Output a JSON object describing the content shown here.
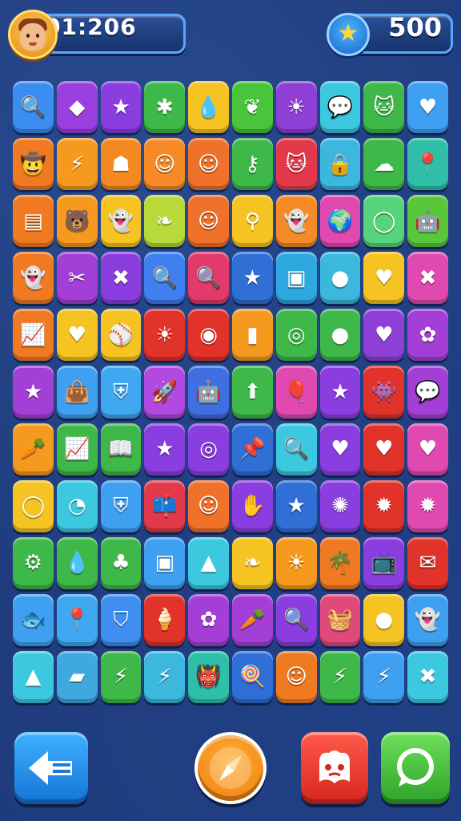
{
  "hud": {
    "timer": "01:206",
    "score": "500",
    "avatar_icon": "player-avatar",
    "score_icon": "star-coin-icon"
  },
  "colors": {
    "background": "#1e3c7c",
    "hud_border": "#5aa7ff"
  },
  "grid": {
    "rows": 11,
    "cols": 10,
    "tiles": [
      [
        {
          "icon": "magnifier",
          "color": "#3b8ef0"
        },
        {
          "icon": "gem",
          "color": "#9b3fe0"
        },
        {
          "icon": "star",
          "color": "#8a3ee0"
        },
        {
          "icon": "bug",
          "color": "#3fb84a"
        },
        {
          "icon": "drop",
          "color": "#f5c422"
        },
        {
          "icon": "leaf",
          "color": "#49c43b"
        },
        {
          "icon": "sun",
          "color": "#8e3fd6"
        },
        {
          "icon": "chat-bubble",
          "color": "#3cc8df"
        },
        {
          "icon": "cat",
          "color": "#3fb84a"
        },
        {
          "icon": "heart",
          "color": "#3f9ff0"
        }
      ],
      [
        {
          "icon": "cowboy",
          "color": "#f07a22"
        },
        {
          "icon": "lightning",
          "color": "#f59a1f"
        },
        {
          "icon": "idol",
          "color": "#f48a1f"
        },
        {
          "icon": "face",
          "color": "#f58a26"
        },
        {
          "icon": "face",
          "color": "#f0712a"
        },
        {
          "icon": "key",
          "color": "#3fb84a"
        },
        {
          "icon": "cat",
          "color": "#e23a4a"
        },
        {
          "icon": "lock",
          "color": "#3cb8df"
        },
        {
          "icon": "cloud",
          "color": "#3fb84a"
        },
        {
          "icon": "map-pin",
          "color": "#2fbfa8"
        }
      ],
      [
        {
          "icon": "card",
          "color": "#f07a22"
        },
        {
          "icon": "bear",
          "color": "#f59a1f"
        },
        {
          "icon": "ghost",
          "color": "#f5c422"
        },
        {
          "icon": "sprout",
          "color": "#b8d93a"
        },
        {
          "icon": "face",
          "color": "#f0712a"
        },
        {
          "icon": "flashlight",
          "color": "#f5c422"
        },
        {
          "icon": "ghost",
          "color": "#f58a26"
        },
        {
          "icon": "globe",
          "color": "#e04ab0"
        },
        {
          "icon": "ring",
          "color": "#57d37a"
        },
        {
          "icon": "robot",
          "color": "#59c73a"
        }
      ],
      [
        {
          "icon": "ghost",
          "color": "#f07a22"
        },
        {
          "icon": "cross-tools",
          "color": "#a33fd6"
        },
        {
          "icon": "x-mark",
          "color": "#8a3ee0"
        },
        {
          "icon": "magnifier",
          "color": "#3f7ff0"
        },
        {
          "icon": "magnifier",
          "color": "#e23a6a"
        },
        {
          "icon": "star",
          "color": "#2f6fd6"
        },
        {
          "icon": "frame",
          "color": "#2fa8df"
        },
        {
          "icon": "lemon",
          "color": "#3cb8df"
        },
        {
          "icon": "heart",
          "color": "#f5c422"
        },
        {
          "icon": "x-mark",
          "color": "#e04ab0"
        }
      ],
      [
        {
          "icon": "chart",
          "color": "#f07a22"
        },
        {
          "icon": "heart",
          "color": "#f5c422"
        },
        {
          "icon": "ball",
          "color": "#f5c422"
        },
        {
          "icon": "sun",
          "color": "#e2332a"
        },
        {
          "icon": "eye",
          "color": "#e2332a"
        },
        {
          "icon": "battery",
          "color": "#f59a1f"
        },
        {
          "icon": "webcam",
          "color": "#3fb84a"
        },
        {
          "icon": "berry",
          "color": "#3fb84a"
        },
        {
          "icon": "heart",
          "color": "#8e3fd6"
        },
        {
          "icon": "flower",
          "color": "#a33fd6"
        }
      ],
      [
        {
          "icon": "star",
          "color": "#a33fd6"
        },
        {
          "icon": "bag",
          "color": "#3f9ff0"
        },
        {
          "icon": "shield",
          "color": "#3fa8f0"
        },
        {
          "icon": "rocket",
          "color": "#b04ae0"
        },
        {
          "icon": "robot",
          "color": "#3f6fe0"
        },
        {
          "icon": "arrow-up",
          "color": "#3fb84a"
        },
        {
          "icon": "balloon",
          "color": "#e04ab0"
        },
        {
          "icon": "star",
          "color": "#8a3ee0"
        },
        {
          "icon": "invader",
          "color": "#e2332a"
        },
        {
          "icon": "chat-bubble",
          "color": "#a33fd6"
        }
      ],
      [
        {
          "icon": "carrot",
          "color": "#f59a1f"
        },
        {
          "icon": "chart",
          "color": "#3fb84a"
        },
        {
          "icon": "book",
          "color": "#3fb84a"
        },
        {
          "icon": "star",
          "color": "#8a3ee0"
        },
        {
          "icon": "target",
          "color": "#8a3ee0"
        },
        {
          "icon": "pin",
          "color": "#2f6fd6"
        },
        {
          "icon": "magnifier",
          "color": "#3cc8df"
        },
        {
          "icon": "heart",
          "color": "#8a3ee0"
        },
        {
          "icon": "heart",
          "color": "#e2332a"
        },
        {
          "icon": "heart",
          "color": "#e04ab0"
        }
      ],
      [
        {
          "icon": "ring",
          "color": "#f5c422"
        },
        {
          "icon": "pie",
          "color": "#3cc8df"
        },
        {
          "icon": "shield",
          "color": "#3f9ff0"
        },
        {
          "icon": "mailbox",
          "color": "#e23a4a"
        },
        {
          "icon": "face",
          "color": "#f0712a"
        },
        {
          "icon": "hand",
          "color": "#8a3ee0"
        },
        {
          "icon": "star",
          "color": "#2f6fd6"
        },
        {
          "icon": "virus",
          "color": "#8a3ee0"
        },
        {
          "icon": "splat",
          "color": "#e2332a"
        },
        {
          "icon": "splat",
          "color": "#e04ab0"
        }
      ],
      [
        {
          "icon": "gear",
          "color": "#3fb84a"
        },
        {
          "icon": "drop",
          "color": "#3fb84a"
        },
        {
          "icon": "plant",
          "color": "#3fb84a"
        },
        {
          "icon": "frame",
          "color": "#3f9ff0"
        },
        {
          "icon": "tree",
          "color": "#3cc8df"
        },
        {
          "icon": "feather",
          "color": "#f5c422"
        },
        {
          "icon": "sun",
          "color": "#f59a1f"
        },
        {
          "icon": "palm",
          "color": "#f07a22"
        },
        {
          "icon": "tv",
          "color": "#8a3ee0"
        },
        {
          "icon": "note",
          "color": "#e2332a"
        }
      ],
      [
        {
          "icon": "fish",
          "color": "#3f9ff0"
        },
        {
          "icon": "map-pin",
          "color": "#3fa8f0"
        },
        {
          "icon": "tooth",
          "color": "#3f8ef0"
        },
        {
          "icon": "ice-cream",
          "color": "#e2332a"
        },
        {
          "icon": "flower",
          "color": "#a33fd6"
        },
        {
          "icon": "carrot",
          "color": "#a33fd6"
        },
        {
          "icon": "magnifier",
          "color": "#8a3ee0"
        },
        {
          "icon": "basket",
          "color": "#e04a7a"
        },
        {
          "icon": "lemon",
          "color": "#f5c422"
        },
        {
          "icon": "ghost",
          "color": "#3f9ff0"
        }
      ],
      [
        {
          "icon": "cone",
          "color": "#3cc8df"
        },
        {
          "icon": "eraser",
          "color": "#3fa8df"
        },
        {
          "icon": "lightning",
          "color": "#3fb84a"
        },
        {
          "icon": "lightning",
          "color": "#3cb8df"
        },
        {
          "icon": "monster",
          "color": "#2fbfa8"
        },
        {
          "icon": "lollipop",
          "color": "#2f6fd6"
        },
        {
          "icon": "face",
          "color": "#f07a22"
        },
        {
          "icon": "lightning",
          "color": "#3fb84a"
        },
        {
          "icon": "lightning",
          "color": "#3f9ff0"
        },
        {
          "icon": "x-mark",
          "color": "#3cc8df"
        }
      ]
    ]
  },
  "buttons": {
    "back_icon": "arrow-left",
    "compass_icon": "compass",
    "mascot_icon": "mascot",
    "chat_icon": "chat"
  }
}
